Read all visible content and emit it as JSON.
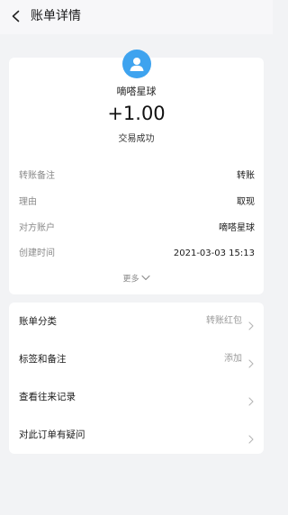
{
  "header": {
    "title": "账单详情",
    "back_icon": "chevron-left-icon"
  },
  "payment": {
    "avatar_icon": "user-avatar-icon",
    "avatar_color": "#3ea3ef",
    "payer_name": "嘀嗒星球",
    "amount": "+1.00",
    "status": "交易成功"
  },
  "details": [
    {
      "label": "转账备注",
      "value": "转账"
    },
    {
      "label": "理由",
      "value": "取现"
    },
    {
      "label": "对方账户",
      "value": "嘀嗒星球"
    },
    {
      "label": "创建时间",
      "value": "2021-03-03 15:13"
    }
  ],
  "more": {
    "label": "更多",
    "icon": "chevron-down-icon"
  },
  "actions": [
    {
      "label": "账单分类",
      "value": "转账红包"
    },
    {
      "label": "标签和备注",
      "value": "添加"
    },
    {
      "label": "查看往来记录",
      "value": ""
    },
    {
      "label": "对此订单有疑问",
      "value": ""
    }
  ]
}
